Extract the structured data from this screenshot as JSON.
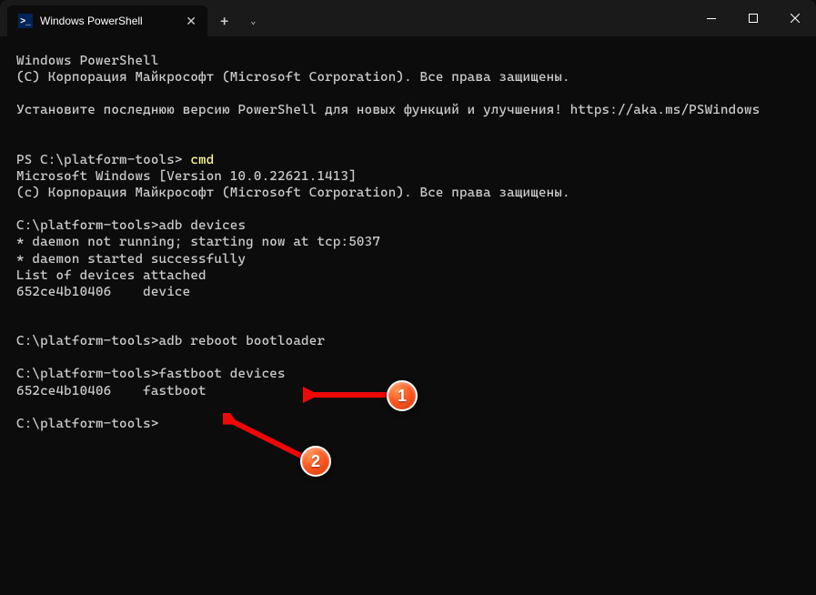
{
  "tab": {
    "title": "Windows PowerShell",
    "icon_glyph": ">_"
  },
  "terminal": {
    "header_line1": "Windows PowerShell",
    "header_line2": "(C) Корпорация Майкрософт (Microsoft Corporation). Все права защищены.",
    "install_msg": "Установите последнюю версию PowerShell для новых функций и улучшения! ",
    "install_link": "https://aka.ms/PSWindows",
    "ps_prompt": "PS C:\\platform-tools> ",
    "cmd_command": "cmd",
    "winver_line": "Microsoft Windows [Version 10.0.22621.1413]",
    "copyright_line": "(c) Корпорация Майкрософт (Microsoft Corporation). Все права защищены.",
    "prompt2": "C:\\platform-tools>",
    "cmd2": "adb devices",
    "daemon1": "* daemon not running; starting now at tcp:5037",
    "daemon2": "* daemon started successfully",
    "list_header": "List of devices attached",
    "device_line": "652ce4b10406    device",
    "prompt3": "C:\\platform-tools>",
    "cmd3": "adb reboot bootloader",
    "prompt4": "C:\\platform-tools>",
    "cmd4": "fastboot devices",
    "fastboot_line": "652ce4b10406    fastboot",
    "prompt5": "C:\\platform-tools>"
  },
  "annotations": {
    "badge1": "1",
    "badge2": "2"
  }
}
